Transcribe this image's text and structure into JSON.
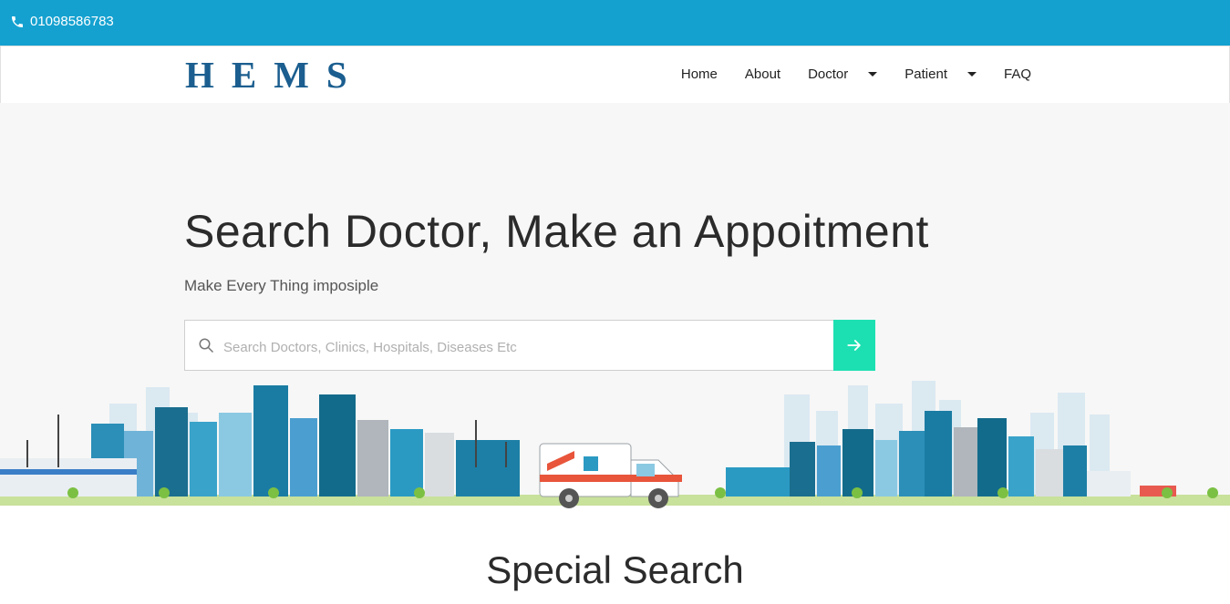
{
  "topbar": {
    "phone": "01098586783",
    "bg": "#14a1d0"
  },
  "brand": {
    "logo": "HEMS",
    "color": "#1b5e8f"
  },
  "nav": {
    "items": [
      {
        "label": "Home",
        "dropdown": false
      },
      {
        "label": "About",
        "dropdown": false
      },
      {
        "label": "Doctor",
        "dropdown": true
      },
      {
        "label": "Patient",
        "dropdown": true
      },
      {
        "label": "FAQ",
        "dropdown": false
      }
    ]
  },
  "hero": {
    "title": "Search Doctor, Make an Appoitment",
    "subtitle": "Make Every Thing imposiple",
    "search_placeholder": "Search Doctors, Clinics, Hospitals, Diseases Etc",
    "search_value": "",
    "accent": "#1de0b2"
  },
  "section": {
    "title": "Special Search"
  },
  "icons": [
    "phone-icon",
    "search-icon",
    "arrow-right-icon",
    "chevron-down-icon"
  ]
}
